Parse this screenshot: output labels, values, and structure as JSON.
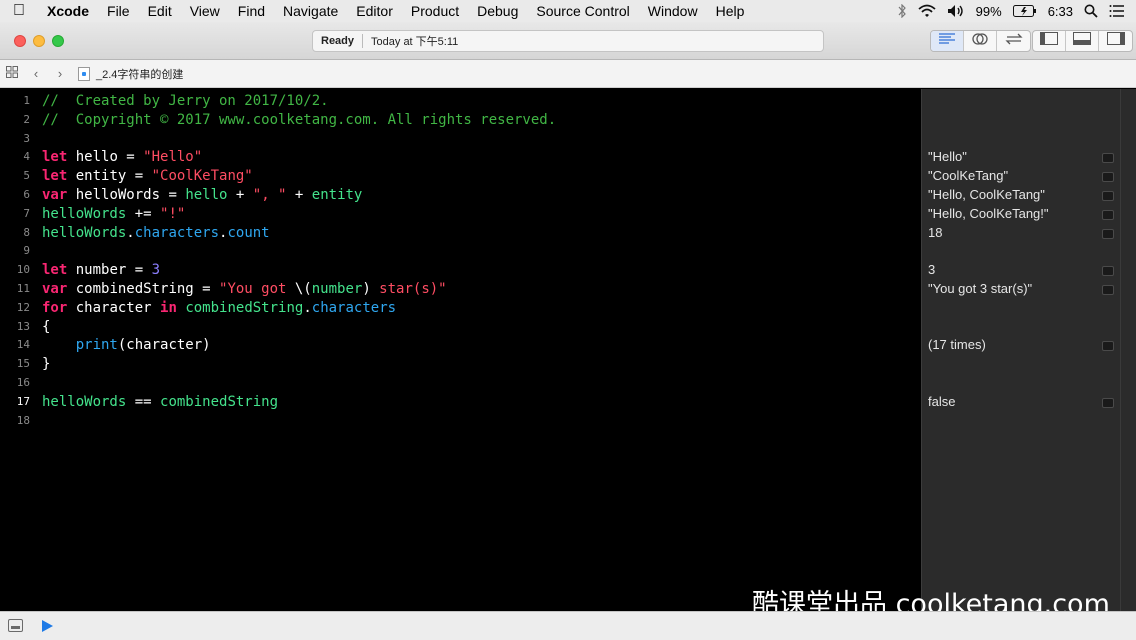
{
  "menubar": {
    "app_name": "Xcode",
    "items": [
      "File",
      "Edit",
      "View",
      "Find",
      "Navigate",
      "Editor",
      "Product",
      "Debug",
      "Source Control",
      "Window",
      "Help"
    ],
    "battery": "99%",
    "time": "6:33"
  },
  "toolbar": {
    "status": "Ready",
    "timestamp": "Today at 下午5:11"
  },
  "jumpbar": {
    "file_name": "_2.4字符串的创建"
  },
  "editor": {
    "current_line": 17,
    "line_numbers": [
      "1",
      "2",
      "3",
      "4",
      "5",
      "6",
      "7",
      "8",
      "9",
      "10",
      "11",
      "12",
      "13",
      "14",
      "15",
      "16",
      "17",
      "18"
    ],
    "lines": [
      [
        {
          "t": "comment",
          "s": "//  Created by Jerry on 2017/10/2."
        }
      ],
      [
        {
          "t": "comment",
          "s": "//  Copyright © 2017 www.coolketang.com. All rights reserved."
        }
      ],
      [],
      [
        {
          "t": "keyword",
          "s": "let"
        },
        {
          "t": "ident",
          "s": " hello = "
        },
        {
          "t": "string",
          "s": "\"Hello\""
        }
      ],
      [
        {
          "t": "keyword",
          "s": "let"
        },
        {
          "t": "ident",
          "s": " entity = "
        },
        {
          "t": "string",
          "s": "\"CoolKeTang\""
        }
      ],
      [
        {
          "t": "keyword",
          "s": "var"
        },
        {
          "t": "ident",
          "s": " helloWords = "
        },
        {
          "t": "project",
          "s": "hello"
        },
        {
          "t": "ident",
          "s": " + "
        },
        {
          "t": "string",
          "s": "\", \""
        },
        {
          "t": "ident",
          "s": " + "
        },
        {
          "t": "project",
          "s": "entity"
        }
      ],
      [
        {
          "t": "project",
          "s": "helloWords"
        },
        {
          "t": "ident",
          "s": " += "
        },
        {
          "t": "string",
          "s": "\"!\""
        }
      ],
      [
        {
          "t": "project",
          "s": "helloWords"
        },
        {
          "t": "ident",
          "s": "."
        },
        {
          "t": "system",
          "s": "characters"
        },
        {
          "t": "ident",
          "s": "."
        },
        {
          "t": "system",
          "s": "count"
        }
      ],
      [],
      [
        {
          "t": "keyword",
          "s": "let"
        },
        {
          "t": "ident",
          "s": " number = "
        },
        {
          "t": "number",
          "s": "3"
        }
      ],
      [
        {
          "t": "keyword",
          "s": "var"
        },
        {
          "t": "ident",
          "s": " combinedString = "
        },
        {
          "t": "string",
          "s": "\"You got "
        },
        {
          "t": "ident",
          "s": "\\("
        },
        {
          "t": "project",
          "s": "number"
        },
        {
          "t": "ident",
          "s": ")"
        },
        {
          "t": "string",
          "s": " star(s)\""
        }
      ],
      [
        {
          "t": "keyword",
          "s": "for"
        },
        {
          "t": "ident",
          "s": " character "
        },
        {
          "t": "keyword",
          "s": "in"
        },
        {
          "t": "ident",
          "s": " "
        },
        {
          "t": "project",
          "s": "combinedString"
        },
        {
          "t": "ident",
          "s": "."
        },
        {
          "t": "system",
          "s": "characters"
        }
      ],
      [
        {
          "t": "ident",
          "s": "{"
        }
      ],
      [
        {
          "t": "ident",
          "s": "    "
        },
        {
          "t": "system",
          "s": "print"
        },
        {
          "t": "ident",
          "s": "(character)"
        }
      ],
      [
        {
          "t": "ident",
          "s": "}"
        }
      ],
      [],
      [
        {
          "t": "project",
          "s": "helloWords"
        },
        {
          "t": "ident",
          "s": " == "
        },
        {
          "t": "project",
          "s": "combinedString"
        }
      ],
      []
    ]
  },
  "results": [
    {
      "line": 4,
      "value": "\"Hello\""
    },
    {
      "line": 5,
      "value": "\"CoolKeTang\""
    },
    {
      "line": 6,
      "value": "\"Hello, CoolKeTang\""
    },
    {
      "line": 7,
      "value": "\"Hello, CoolKeTang!\""
    },
    {
      "line": 8,
      "value": "18"
    },
    {
      "line": 10,
      "value": "3"
    },
    {
      "line": 11,
      "value": "\"You got 3 star(s)\""
    },
    {
      "line": 14,
      "value": "(17 times)"
    },
    {
      "line": 17,
      "value": "false"
    }
  ],
  "watermark": "酷课堂出品 coolketang.com"
}
